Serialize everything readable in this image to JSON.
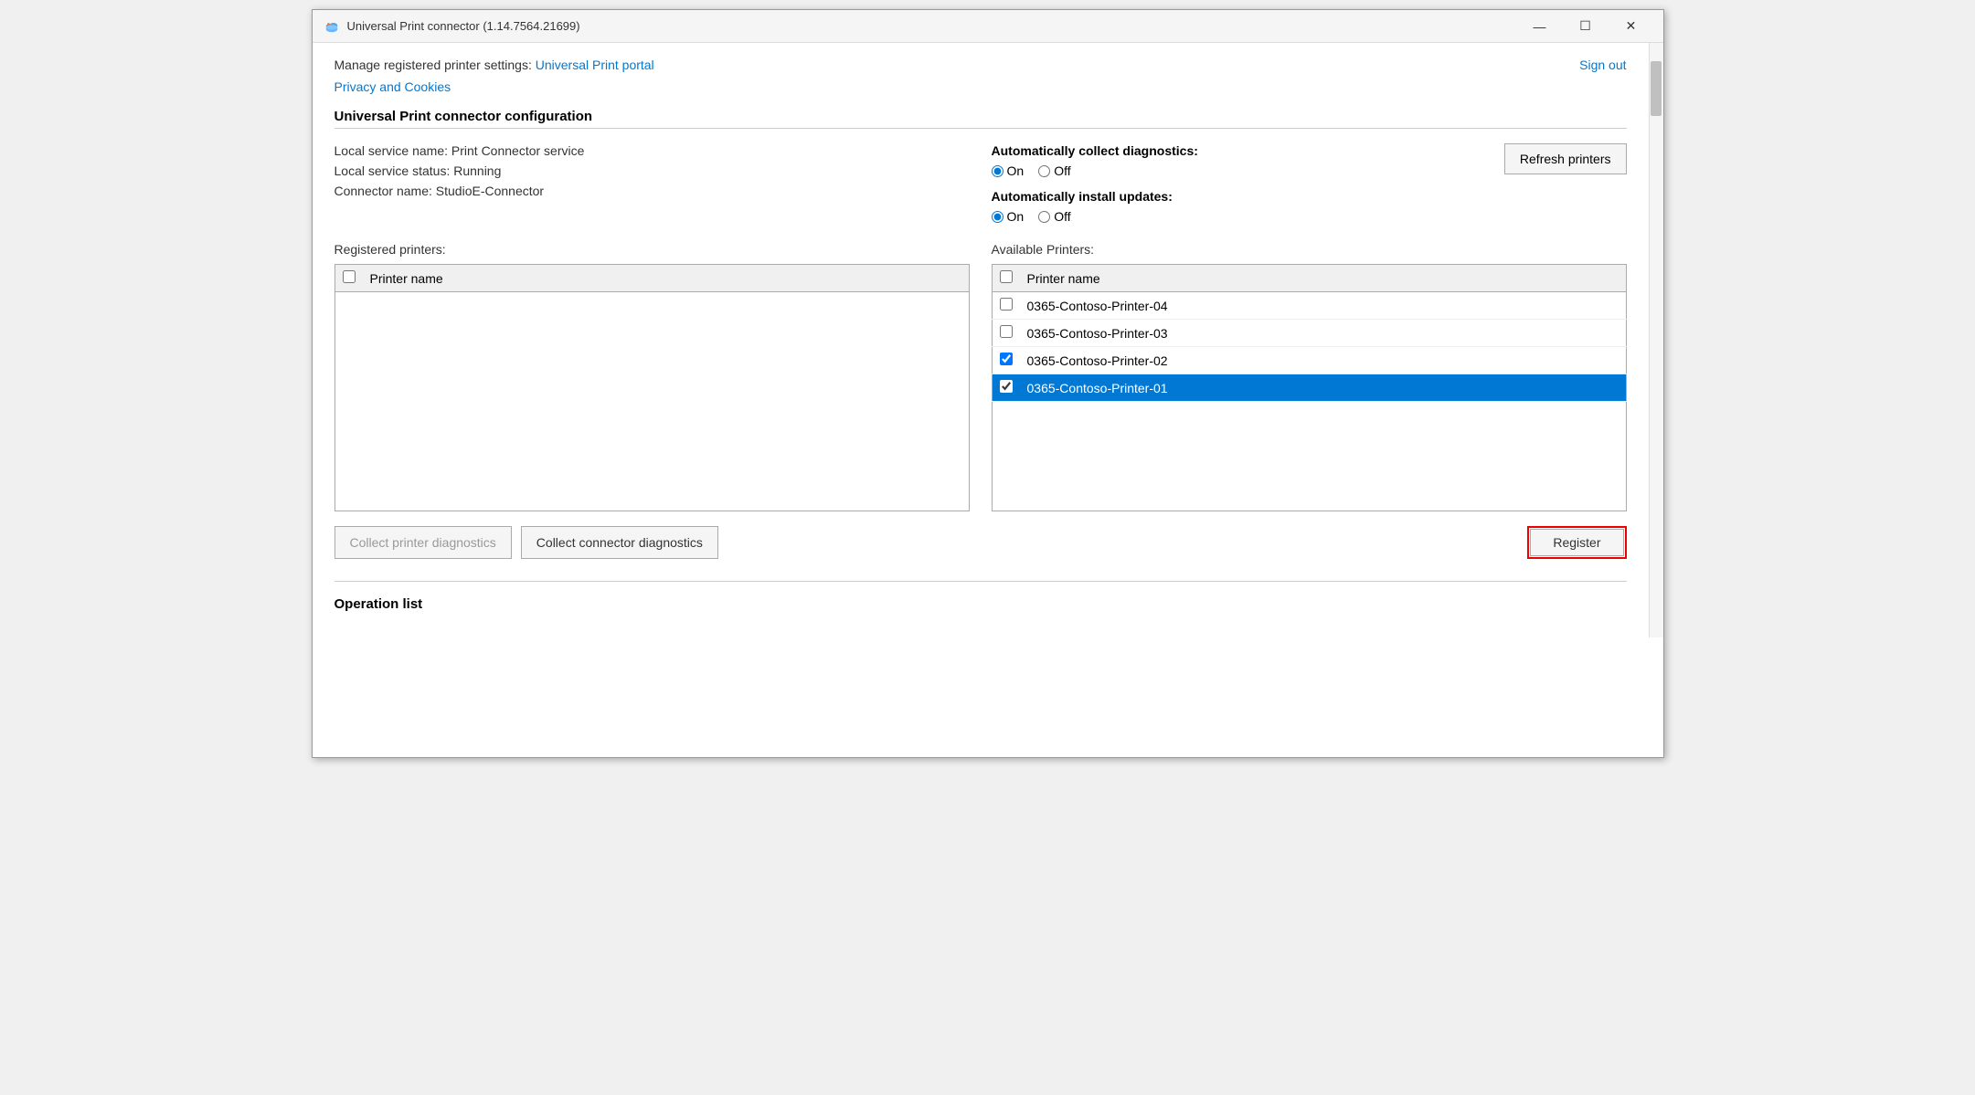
{
  "window": {
    "title": "Universal Print connector (1.14.7564.21699)",
    "min_btn": "—",
    "max_btn": "☐",
    "close_btn": "✕"
  },
  "header": {
    "manage_text": "Manage registered printer settings:",
    "portal_link": "Universal Print portal",
    "sign_out": "Sign out",
    "privacy_link": "Privacy and Cookies"
  },
  "config_section": {
    "title": "Universal Print connector configuration",
    "service_name": "Local service name: Print Connector service",
    "service_status": "Local service status: Running",
    "connector_name": "Connector name: StudioE-Connector",
    "auto_diagnostics_label": "Automatically collect diagnostics:",
    "auto_diagnostics_on": "On",
    "auto_diagnostics_off": "Off",
    "auto_updates_label": "Automatically install updates:",
    "auto_updates_on": "On",
    "auto_updates_off": "Off",
    "refresh_btn": "Refresh printers"
  },
  "registered_printers": {
    "label": "Registered printers:",
    "col_header": "Printer name",
    "items": []
  },
  "available_printers": {
    "label": "Available Printers:",
    "col_header": "Printer name",
    "items": [
      {
        "name": "0365-Contoso-Printer-04",
        "checked": false,
        "selected": false
      },
      {
        "name": "0365-Contoso-Printer-03",
        "checked": false,
        "selected": false
      },
      {
        "name": "0365-Contoso-Printer-02",
        "checked": true,
        "selected": false
      },
      {
        "name": "0365-Contoso-Printer-01",
        "checked": true,
        "selected": true
      }
    ]
  },
  "buttons": {
    "collect_printer_diag": "Collect printer diagnostics",
    "collect_connector_diag": "Collect connector diagnostics",
    "register": "Register"
  },
  "operation_list": {
    "title": "Operation list"
  }
}
